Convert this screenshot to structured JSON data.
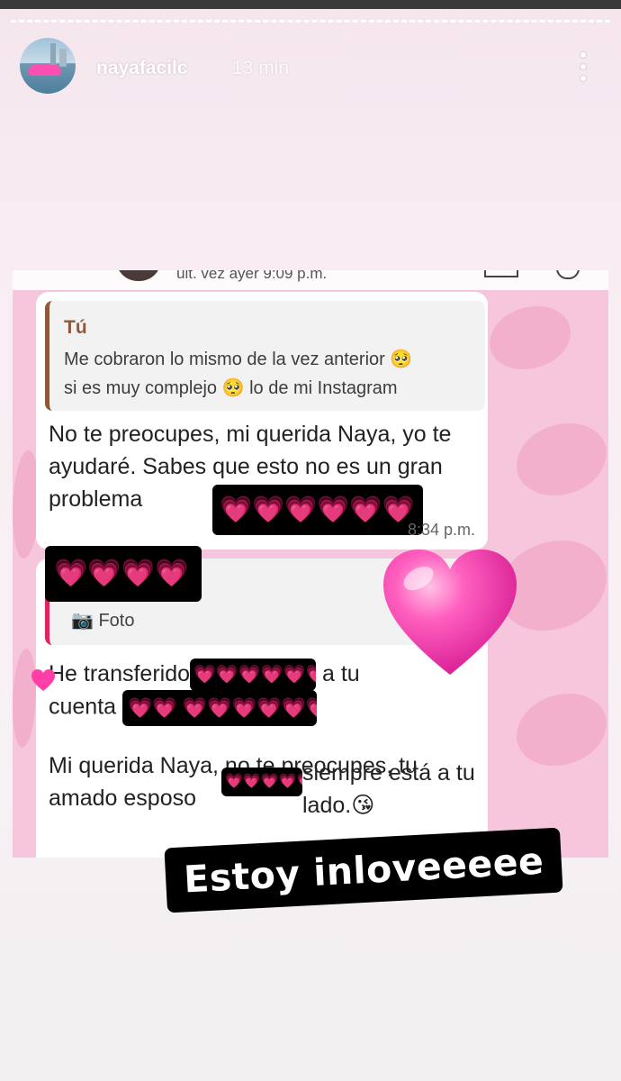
{
  "story": {
    "username": "nayafacilc",
    "time_ago": "13 min"
  },
  "chat": {
    "status": "últ. vez ayer 9:09 p.m.",
    "quoted": {
      "author": "Tú",
      "line1": "Me cobraron lo mismo de la vez anterior 🥺",
      "line2": "si es muy complejo 🥺  lo de mi Instagram"
    },
    "reply": {
      "text_a": "No te preocupes, mi querida Naya, yo te ayudaré. Sabes que esto no es un gran problema",
      "censored_hearts": "💗💗💗💗💗💗",
      "time": "8:34 p.m."
    },
    "second_quote": {
      "censored_hearts": "💗💗💗💗",
      "label": "Foto"
    },
    "message2": {
      "p1_a": "He transferido",
      "p1_hearts_a": "💗💗💗💗💗💗",
      "p1_b": " a tu",
      "p1_c": "cuenta",
      "p1_hearts_b": "💗💗 💗💗💗💗💗💗",
      "p2_a": "Mi querida Naya, no te preocupes, tu amado esposo",
      "p2_hearts": "💗💗💗💗💗",
      "p2_b": "siempre está a tu lado.😘"
    }
  },
  "sticker_text": "Estoy inloveeeee",
  "colors": {
    "accent_pink": "#ff3fa5",
    "quote_brown": "#8c5a3a",
    "quote_red": "#e0245e"
  }
}
